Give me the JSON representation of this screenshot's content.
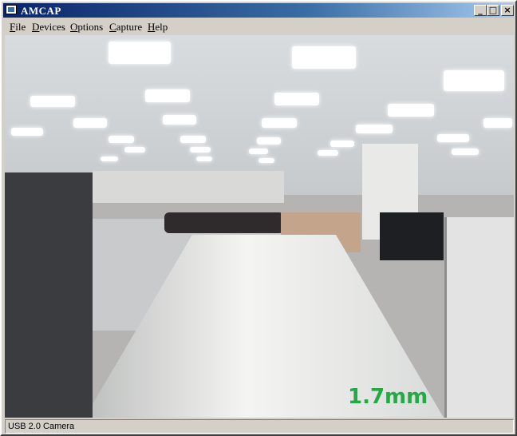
{
  "window": {
    "title": "AMCAP"
  },
  "window_buttons": {
    "minimize": "_",
    "maximize": "□",
    "close": "×"
  },
  "menu": {
    "items": [
      {
        "label": "File",
        "accel": "F",
        "rest": "ile"
      },
      {
        "label": "Devices",
        "accel": "D",
        "rest": "evices"
      },
      {
        "label": "Options",
        "accel": "O",
        "rest": "ptions"
      },
      {
        "label": "Capture",
        "accel": "C",
        "rest": "apture"
      },
      {
        "label": "Help",
        "accel": "H",
        "rest": "elp"
      }
    ]
  },
  "video": {
    "overlay_text": "1.7mm",
    "overlay_color": "#22aa44"
  },
  "status": {
    "text": "USB 2.0 Camera"
  },
  "colors": {
    "title_bar": "#0a246a",
    "chrome": "#d4d0c8"
  }
}
